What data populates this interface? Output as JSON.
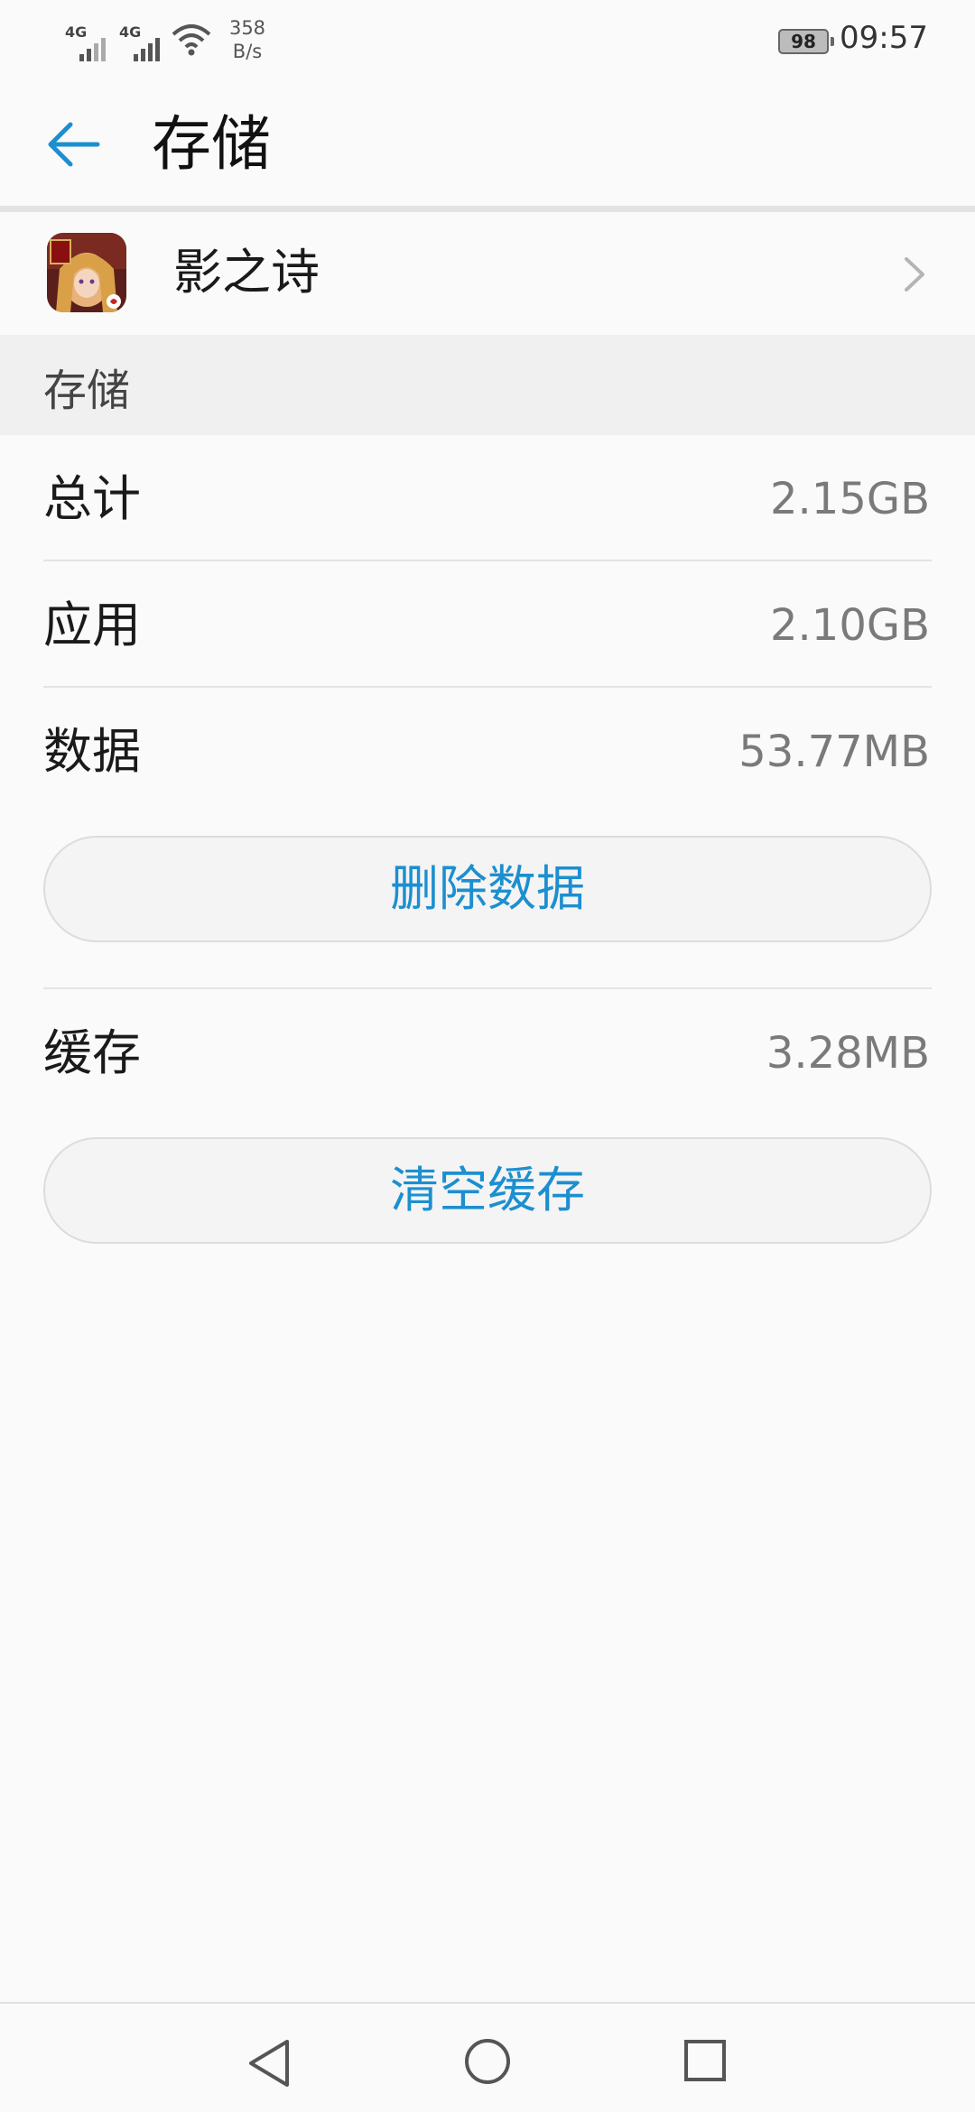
{
  "status_bar": {
    "network_1": "4G",
    "network_2": "4G",
    "speed_value": "358",
    "speed_unit": "B/s",
    "battery": "98",
    "time": "09:57"
  },
  "header": {
    "title": "存储"
  },
  "app": {
    "name": "影之诗"
  },
  "section": {
    "title": "存储"
  },
  "rows": {
    "total": {
      "label": "总计",
      "value": "2.15GB"
    },
    "app": {
      "label": "应用",
      "value": "2.10GB"
    },
    "data": {
      "label": "数据",
      "value": "53.77MB"
    },
    "cache": {
      "label": "缓存",
      "value": "3.28MB"
    }
  },
  "buttons": {
    "delete_data": "删除数据",
    "clear_cache": "清空缓存"
  },
  "colors": {
    "accent": "#1c8fd0",
    "background": "#fafafa"
  }
}
